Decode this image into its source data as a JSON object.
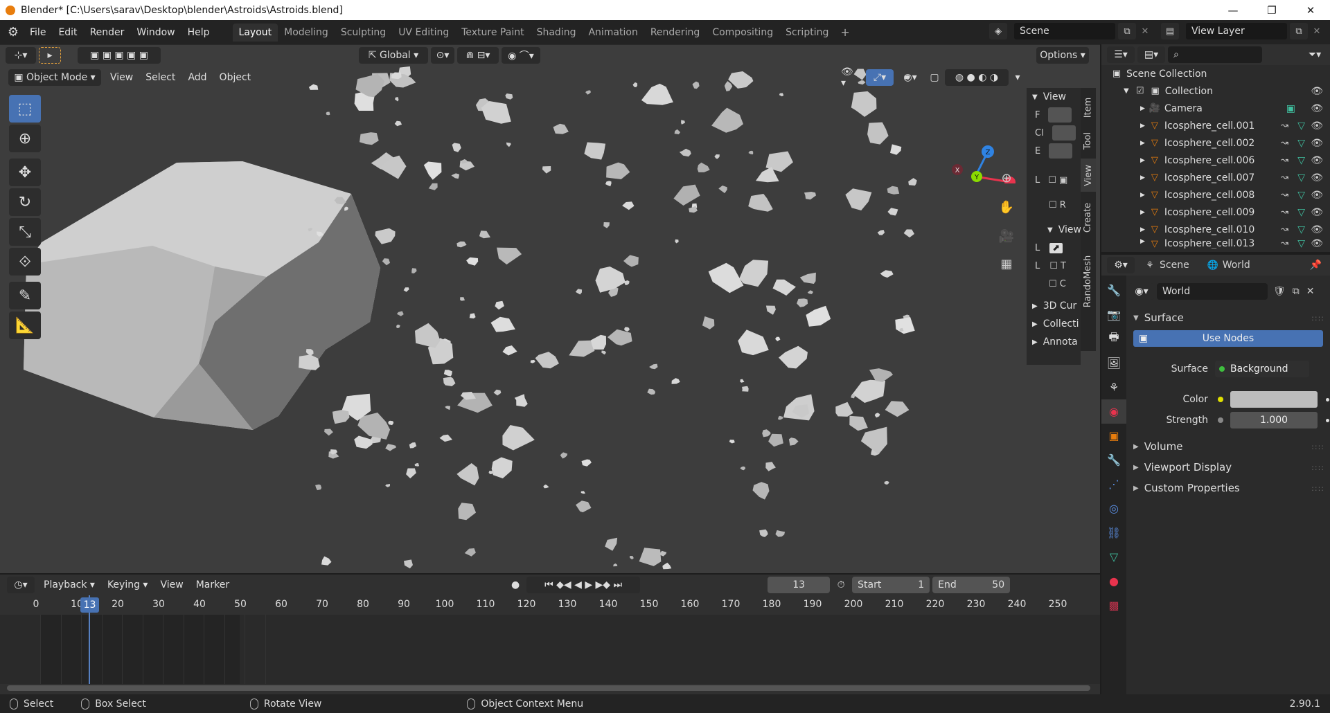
{
  "window": {
    "title": "Blender* [C:\\Users\\sarav\\Desktop\\blender\\Astroids\\Astroids.blend]",
    "minimize": "—",
    "maximize": "❐",
    "close": "✕"
  },
  "menu": [
    "File",
    "Edit",
    "Render",
    "Window",
    "Help"
  ],
  "workspaces": [
    "Layout",
    "Modeling",
    "Sculpting",
    "UV Editing",
    "Texture Paint",
    "Shading",
    "Animation",
    "Rendering",
    "Compositing",
    "Scripting"
  ],
  "active_workspace": "Layout",
  "scene": "Scene",
  "view_layer": "View Layer",
  "viewport": {
    "transform_orientation": "Global",
    "options": "Options",
    "mode": "Object Mode",
    "menus": [
      "View",
      "Select",
      "Add",
      "Object"
    ],
    "gizmo_axes": [
      "X",
      "Y",
      "Z"
    ]
  },
  "npanel": {
    "tabs": [
      "Item",
      "Tool",
      "View",
      "Create",
      "RandoMesh"
    ],
    "view_header": "View",
    "rows": [
      "F",
      "Cl",
      "E",
      "L",
      "R"
    ],
    "view2_header": "View",
    "rows2": [
      "L",
      "L",
      "T",
      "C"
    ],
    "sections": [
      "3D Cur",
      "Collecti",
      "Annota"
    ]
  },
  "timeline": {
    "menus": [
      "Playback",
      "Keying",
      "View",
      "Marker"
    ],
    "current_frame": "13",
    "start_label": "Start",
    "start": "1",
    "end_label": "End",
    "end": "50",
    "ticks": [
      "0",
      "10",
      "20",
      "30",
      "40",
      "50",
      "60",
      "70",
      "80",
      "90",
      "100",
      "110",
      "120",
      "130",
      "140",
      "150",
      "160",
      "170",
      "180",
      "190",
      "200",
      "210",
      "220",
      "230",
      "240",
      "250"
    ]
  },
  "status": {
    "select": "Select",
    "box_select": "Box Select",
    "rotate": "Rotate View",
    "context": "Object Context Menu",
    "version": "2.90.1"
  },
  "outliner": {
    "root": "Scene Collection",
    "collection": "Collection",
    "items": [
      "Camera",
      "Icosphere_cell.001",
      "Icosphere_cell.002",
      "Icosphere_cell.006",
      "Icosphere_cell.007",
      "Icosphere_cell.008",
      "Icosphere_cell.009",
      "Icosphere_cell.010",
      "Icosphere_cell.013"
    ]
  },
  "properties": {
    "breadcrumb_scene": "Scene",
    "breadcrumb_world": "World",
    "world_name": "World",
    "surface_header": "Surface",
    "use_nodes": "Use Nodes",
    "surface_label": "Surface",
    "surface_value": "Background",
    "color_label": "Color",
    "strength_label": "Strength",
    "strength_value": "1.000",
    "sections": [
      "Volume",
      "Viewport Display",
      "Custom Properties"
    ]
  },
  "colors": {
    "accent": "#4772b3",
    "axis_x": "#e8334d",
    "axis_y": "#8bdc00",
    "axis_z": "#2f83e3",
    "object_orange": "#e87d0d",
    "modifier_teal": "#3fbf9f"
  }
}
